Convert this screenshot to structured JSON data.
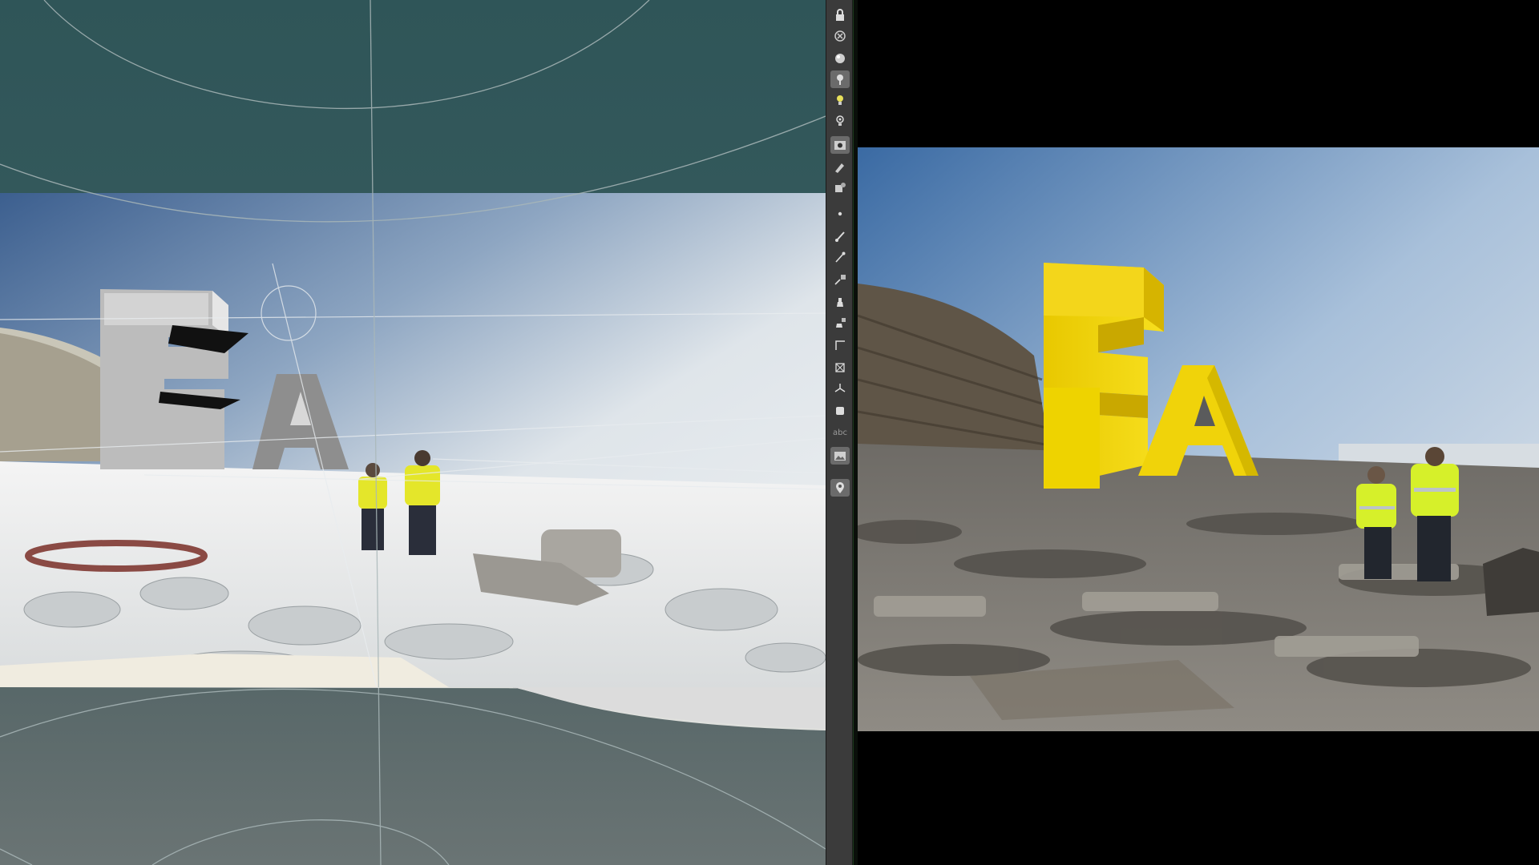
{
  "toolbar": {
    "tools": [
      {
        "name": "lock-icon",
        "active": false
      },
      {
        "name": "close-circle-icon",
        "active": false
      },
      {
        "name": "sphere-icon",
        "active": false
      },
      {
        "name": "pin-icon",
        "active": true
      },
      {
        "name": "light-bulb-icon",
        "active": false
      },
      {
        "name": "light-target-icon",
        "active": false
      },
      {
        "name": "camera-view-icon",
        "active": true
      },
      {
        "name": "pen-tool-icon",
        "active": false
      },
      {
        "name": "object-tool-icon",
        "active": false
      },
      {
        "name": "dot-icon",
        "active": false
      },
      {
        "name": "brush-icon",
        "active": false
      },
      {
        "name": "pipette-icon",
        "active": false
      },
      {
        "name": "number-tool-icon",
        "active": false
      },
      {
        "name": "stamp-icon",
        "active": false
      },
      {
        "name": "number-stamp-icon",
        "active": false
      },
      {
        "name": "corner-icon",
        "active": false
      },
      {
        "name": "transform-icon",
        "active": false
      },
      {
        "name": "axis-icon",
        "active": false
      },
      {
        "name": "square-icon",
        "active": false
      },
      {
        "name": "image-icon",
        "active": true
      },
      {
        "name": "map-pin-icon",
        "active": true
      }
    ],
    "text_tool_label": "abc"
  },
  "scene": {
    "letters": [
      "E",
      "A"
    ],
    "letter_color_render": "#f4d70a",
    "letter_color_viewport": "#b5b5b5",
    "viewport_bg": "#2f5558",
    "background": "#000000"
  }
}
